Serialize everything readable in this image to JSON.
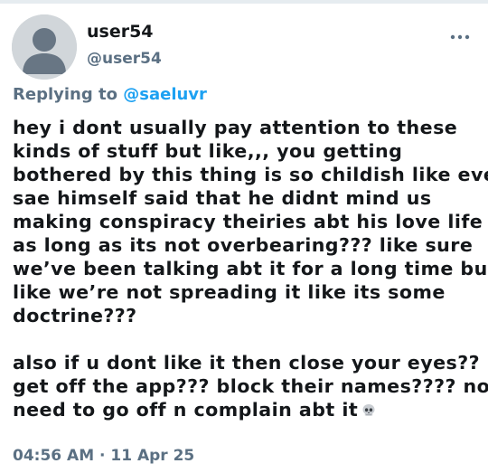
{
  "tweet": {
    "username": "user54",
    "handle": "@user54",
    "avatar_icon": "default-avatar-icon",
    "more_icon": "more-options-icon",
    "replying_prefix": "Replying to",
    "replying_handle": "@saeluvr",
    "body_lines": [
      "hey i dont usually pay attention to these",
      "kinds of stuff but like,,, you getting",
      "bothered by this thing is so childish like even",
      "sae himself said that he didnt mind us",
      "making conspiracy theiries abt his love life",
      "as long as its not overbearing??? like sure",
      "we’ve been talking abt it for a long time but",
      "like we’re not spreading it like its some",
      "doctrine???"
    ],
    "body_lines_2": [
      "also if u dont like it then close your eyes??",
      "get off the app??? block their names???? no",
      "need to go off n complain abt it"
    ],
    "emoji_icon": "skull-icon",
    "timestamp": "04:56 AM · 11 Apr 25",
    "colors": {
      "accent": "#1da1f2",
      "secondary_text": "#5b7083",
      "primary_text": "#14171a",
      "avatar_bg": "#d1d6da",
      "avatar_fg": "#687684"
    }
  }
}
